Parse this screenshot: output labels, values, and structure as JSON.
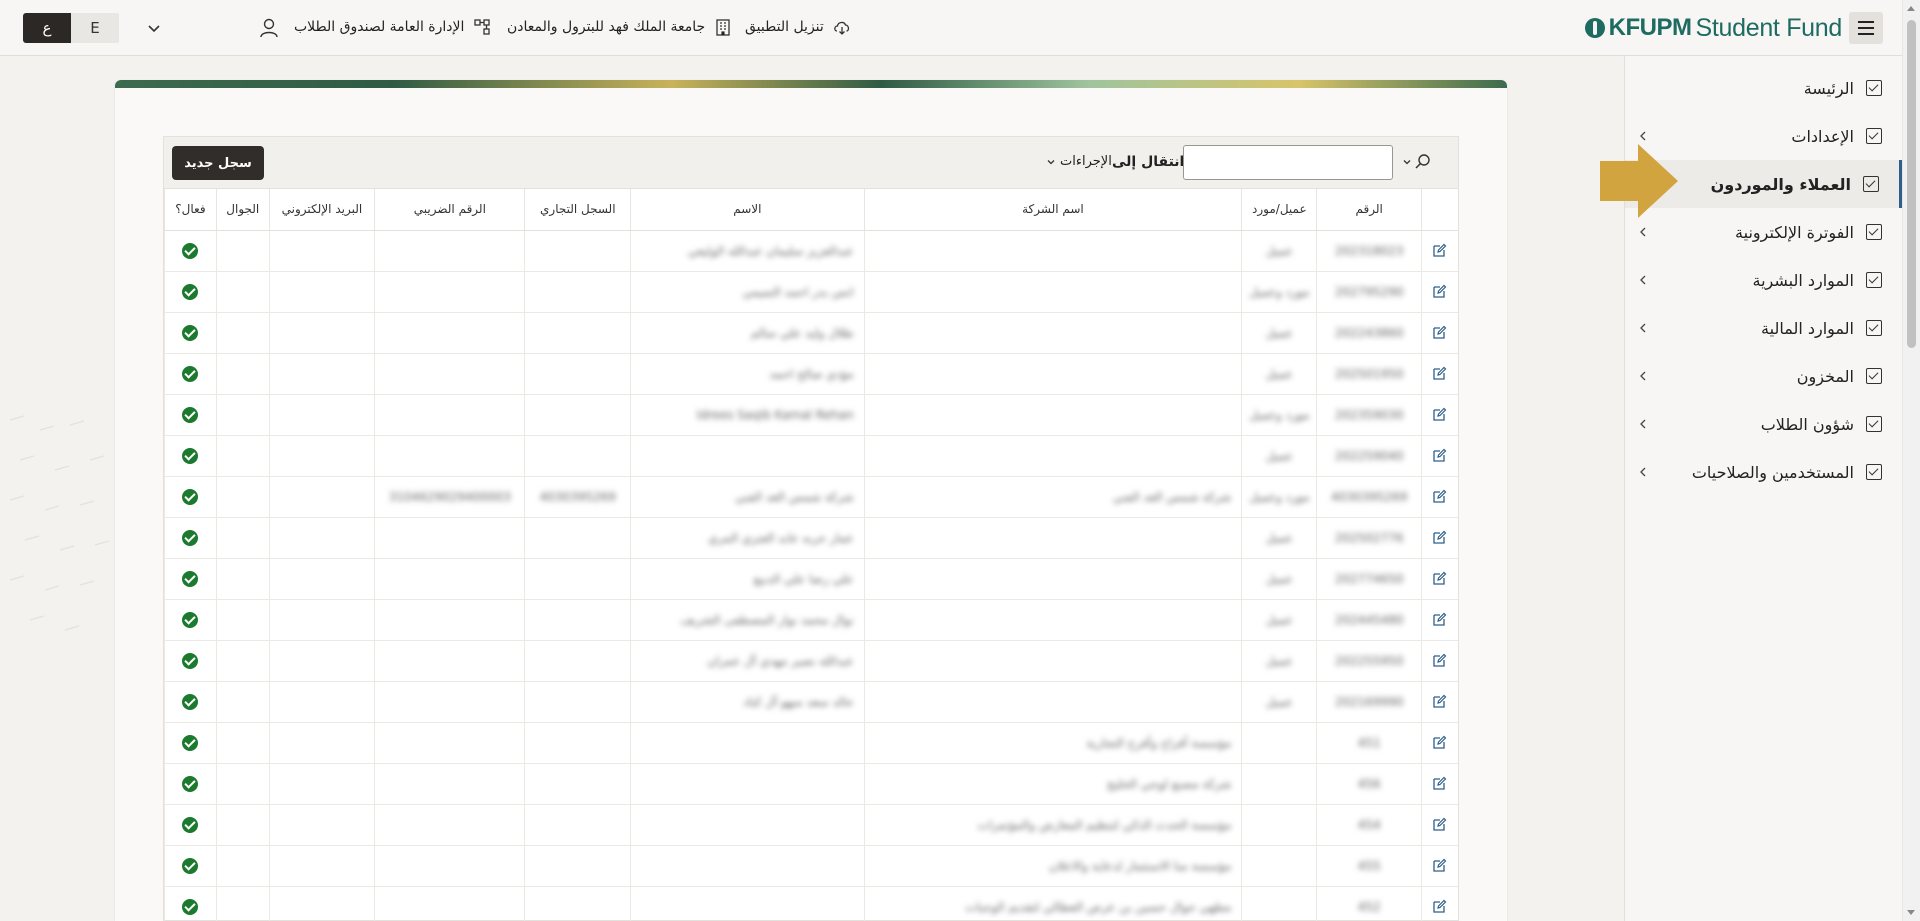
{
  "topbar": {
    "lang_ar": "ع",
    "lang_en": "E",
    "download_app": "تنزيل التطبيق",
    "university": "جامعة الملك فهد للبترول والمعادن",
    "department": "الإدارة العامة لصندوق الطلاب",
    "brand_kfupm": "KFUPM",
    "brand_fund": "Student Fund"
  },
  "sidebar": {
    "items": [
      {
        "label": "الرئيسة",
        "has_chevron": false,
        "active": false
      },
      {
        "label": "الإعدادات",
        "has_chevron": true,
        "active": false
      },
      {
        "label": "العملاء والموردون",
        "has_chevron": false,
        "active": true
      },
      {
        "label": "الفوترة الإلكترونية",
        "has_chevron": true,
        "active": false
      },
      {
        "label": "الموارد البشرية",
        "has_chevron": true,
        "active": false
      },
      {
        "label": "الموارد المالية",
        "has_chevron": true,
        "active": false
      },
      {
        "label": "المخزون",
        "has_chevron": true,
        "active": false
      },
      {
        "label": "شؤون الطلاب",
        "has_chevron": true,
        "active": false
      },
      {
        "label": "المستخدمين والصلاحيات",
        "has_chevron": true,
        "active": false
      }
    ]
  },
  "toolbar": {
    "new_record": "سجل جديد",
    "actions": "الإجراءات",
    "goto": "انتقال إلى",
    "search_value": ""
  },
  "table": {
    "headers": [
      "",
      "الرقم",
      "عميل/مورد",
      "اسم الشركة",
      "الاسم",
      "السجل التجاري",
      "الرقم الضريبي",
      "البريد الإلكتروني",
      "الجوال",
      "فعال؟"
    ],
    "rows": [
      {
        "number": "202318023",
        "type": "عميل",
        "company": "",
        "name": "عبدالعزيز سليمان عبدالله الوليعي",
        "cr": "",
        "vat": "",
        "email": "",
        "mobile": ""
      },
      {
        "number": "202795290",
        "type": "مورد وعميل",
        "company": "",
        "name": "انس بدر احمد التميمي",
        "cr": "",
        "vat": "",
        "email": "",
        "mobile": ""
      },
      {
        "number": "202243860",
        "type": "عميل",
        "company": "",
        "name": "طلال وليد علي سالم",
        "cr": "",
        "vat": "",
        "email": "",
        "mobile": ""
      },
      {
        "number": "202501950",
        "type": "عميل",
        "company": "",
        "name": "مؤدي صالح احمد",
        "cr": "",
        "vat": "",
        "email": "",
        "mobile": ""
      },
      {
        "number": "202359030",
        "type": "مورد وعميل",
        "company": "",
        "name": "Idrees Saqib Kamal Rehan",
        "cr": "",
        "vat": "",
        "email": "",
        "mobile": ""
      },
      {
        "number": "202259040",
        "type": "عميل",
        "company": "",
        "name": "",
        "cr": "",
        "vat": "",
        "email": "",
        "mobile": ""
      },
      {
        "number": "4030395269",
        "type": "مورد وعميل",
        "company": "شركة شمس الغد الفني",
        "name": "شركة شمس الغد الفني",
        "cr": "4030395269",
        "vat": "3104629029400003",
        "email": "",
        "mobile": ""
      },
      {
        "number": "202502776",
        "type": "عميل",
        "company": "",
        "name": "عمار حربه عابد العنزي المري",
        "cr": "",
        "vat": "",
        "email": "",
        "mobile": ""
      },
      {
        "number": "202774650",
        "type": "عميل",
        "company": "",
        "name": "علي رضا علي الدبيع",
        "cr": "",
        "vat": "",
        "email": "",
        "mobile": ""
      },
      {
        "number": "202445480",
        "type": "عميل",
        "company": "",
        "name": "نوال محمد نوار المصطفى الشريف",
        "cr": "",
        "vat": "",
        "email": "",
        "mobile": ""
      },
      {
        "number": "202255950",
        "type": "عميل",
        "company": "",
        "name": "عبدالله نصير مهدي آل عمران",
        "cr": "",
        "vat": "",
        "email": "",
        "mobile": ""
      },
      {
        "number": "202169990",
        "type": "عميل",
        "company": "",
        "name": "خالد سعد سهو آل كناد",
        "cr": "",
        "vat": "",
        "email": "",
        "mobile": ""
      },
      {
        "number": "451",
        "type": "",
        "company": "مؤسسة أفراح وأفرح التجارية",
        "name": "",
        "cr": "",
        "vat": "",
        "email": "",
        "mobile": ""
      },
      {
        "number": "456",
        "type": "",
        "company": "شركة مصنع لوجي الخليج",
        "name": "",
        "cr": "",
        "vat": "",
        "email": "",
        "mobile": ""
      },
      {
        "number": "454",
        "type": "",
        "company": "مؤسسة الحدث الذكي لتنظيم المعارض والمؤتمرات",
        "name": "",
        "cr": "",
        "vat": "",
        "email": "",
        "mobile": ""
      },
      {
        "number": "455",
        "type": "",
        "company": "مؤسسة منا الاستثمار لدعاية والاعلان",
        "name": "",
        "cr": "",
        "vat": "",
        "email": "",
        "mobile": ""
      },
      {
        "number": "452",
        "type": "",
        "company": "مطهي جوال حسين بن عرض العطالي لتقديم الوجبات",
        "name": "",
        "cr": "",
        "vat": "",
        "email": "",
        "mobile": ""
      }
    ]
  },
  "colors": {
    "brand": "#1e6b62",
    "active_ok": "#1b7a2e",
    "pointer": "#d2a43f"
  }
}
